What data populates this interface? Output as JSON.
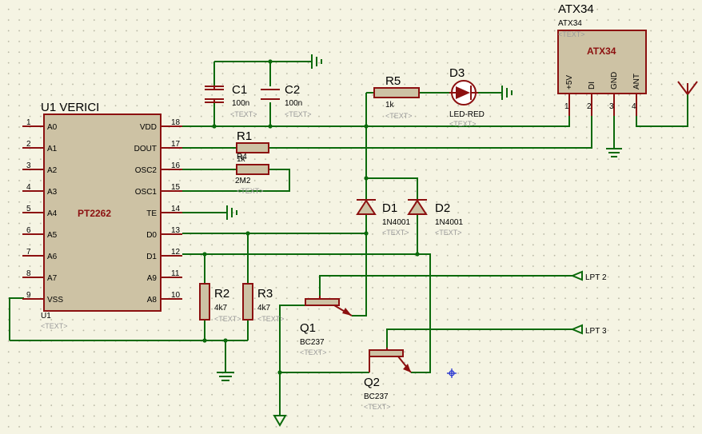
{
  "u1": {
    "ref": "U1 VERICI",
    "part": "PT2262",
    "bottom_ref": "U1",
    "text": "<TEXT>",
    "left_pins": [
      {
        "num": "1",
        "name": "A0"
      },
      {
        "num": "2",
        "name": "A1"
      },
      {
        "num": "3",
        "name": "A2"
      },
      {
        "num": "4",
        "name": "A3"
      },
      {
        "num": "5",
        "name": "A4"
      },
      {
        "num": "6",
        "name": "A5"
      },
      {
        "num": "7",
        "name": "A6"
      },
      {
        "num": "8",
        "name": "A7"
      },
      {
        "num": "9",
        "name": "VSS"
      }
    ],
    "right_pins": [
      {
        "num": "18",
        "name": "VDD"
      },
      {
        "num": "17",
        "name": "DOUT"
      },
      {
        "num": "16",
        "name": "OSC2"
      },
      {
        "num": "15",
        "name": "OSC1"
      },
      {
        "num": "14",
        "name": "TE"
      },
      {
        "num": "13",
        "name": "D0"
      },
      {
        "num": "12",
        "name": "D1"
      },
      {
        "num": "11",
        "name": "A9"
      },
      {
        "num": "10",
        "name": "A8"
      }
    ]
  },
  "atx": {
    "ref": "ATX34",
    "value": "ATX34",
    "text": "<TEXT>",
    "part": "ATX34",
    "pins": [
      {
        "num": "1",
        "name": "+5V"
      },
      {
        "num": "2",
        "name": "DI"
      },
      {
        "num": "3",
        "name": "GND"
      },
      {
        "num": "4",
        "name": "ANT"
      }
    ]
  },
  "c1": {
    "ref": "C1",
    "value": "100n",
    "text": "<TEXT>"
  },
  "c2": {
    "ref": "C2",
    "value": "100n",
    "text": "<TEXT>"
  },
  "r5": {
    "ref": "R5",
    "value": "1k",
    "text": "<TEXT>"
  },
  "d3": {
    "ref": "D3",
    "value": "LED-RED",
    "text": "<TEXT>"
  },
  "r1": {
    "ref": "R1",
    "value": "1k"
  },
  "r4": {
    "ref": "R4",
    "value": "2M2",
    "text": "<TEXT>"
  },
  "d1": {
    "ref": "D1",
    "value": "1N4001",
    "text": "<TEXT>"
  },
  "d2": {
    "ref": "D2",
    "value": "1N4001",
    "text": "<TEXT>"
  },
  "r2": {
    "ref": "R2",
    "value": "4k7",
    "text": "<TEXT>"
  },
  "r3": {
    "ref": "R3",
    "value": "4k7",
    "text": "<TEXT>"
  },
  "q1": {
    "ref": "Q1",
    "value": "BC237",
    "text": "<TEXT>"
  },
  "q2": {
    "ref": "Q2",
    "value": "BC237",
    "text": "<TEXT>"
  },
  "lpt2": {
    "label": "LPT 2"
  },
  "lpt3": {
    "label": "LPT 3"
  },
  "colors": {
    "wire": "#0b6a0b",
    "part": "#8c1010",
    "body": "#cdc2a4",
    "bg": "#f5f4e3",
    "text_marker": "#9a9a9a"
  }
}
